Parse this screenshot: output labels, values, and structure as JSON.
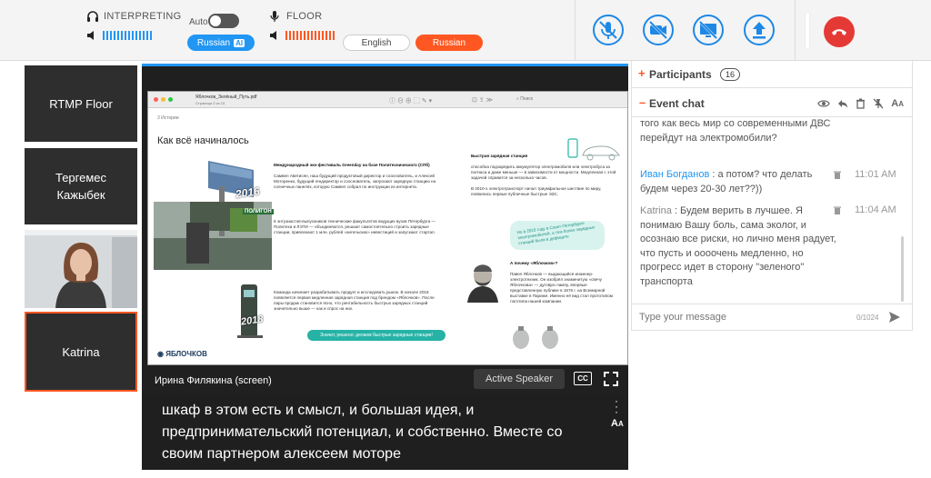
{
  "toolbar": {
    "interpreting_label": "INTERPRETING",
    "auto_label": "Auto",
    "interpreting_lang_button": "Russian",
    "ai_badge": "AI",
    "floor_label": "FLOOR",
    "lang_options": [
      "English",
      "Russian"
    ],
    "selected_lang": "Russian",
    "colors": {
      "accent_blue": "#2196f3",
      "accent_orange": "#ff5722",
      "hangup_red": "#e53935"
    },
    "controls": [
      {
        "name": "mute-mic-button",
        "icon": "mic-off-icon"
      },
      {
        "name": "camera-off-button",
        "icon": "camera-off-icon"
      },
      {
        "name": "screen-share-off-button",
        "icon": "screen-share-off-icon"
      },
      {
        "name": "upload-button",
        "icon": "upload-icon"
      }
    ]
  },
  "participants_tiles": [
    {
      "name": "RTMP Floor"
    },
    {
      "name": "Тергемес\nКажыбек"
    },
    {
      "name": ""
    },
    {
      "name": "Katrina"
    }
  ],
  "stage": {
    "slide": {
      "file_name": "Яблочков_Зелёный_Путь.pdf",
      "page_info": "Страница 3 из 15",
      "search_placeholder": "Поиск",
      "section_tag": "3   Истории",
      "heading": "Как всё начиналось",
      "para1_title": "Международный эко-фестиваль Greenday на базе Политехнического (СПб)",
      "para1_body": "Самвел Аветисян, наш будущий продуктовый директор и сооснователь, и Алексей Моторенко, будущий гендиректор и сооснователь, запускают зарядную станцию на солнечных панелях, которую Самвел собрал по инструкции из интернета.",
      "para2_body": "6 энтузиастов-выпускников технические факультетов ведущих вузов Петербурга — Политеха и ЛЭТИ — объединяются, решают самостоятельно строить зарядные станции, привлекают 1 млн. рублей «ангельских» инвестиций и запускают стартап.",
      "para3_body": "Команда начинает разрабатывать продукт и исследовать рынок. В начале 2018 появляется первая медленная зарядная станция под брендом «Яблочков». После пары продаж становится ясно, что рентабельность быстрых зарядных станций значительно выше — как и спрос на них.",
      "right_title": "Быстрая зарядная станция",
      "right_body1": "способна подзарядить аккумулятор электромобиля или электробуса за полчаса и даже меньше — в зависимости от мощности. Медленная с этой задачей справится за несколько часов.",
      "right_body2": "В 2010-х электротранспорт начал триумфальное шествие по миру, появились первые публичные быстрые ЭЗС.",
      "right_callout": "Но в 2016 году в Санкт-Петербурге электромобилей, а тем более зарядных станций были в дефиците",
      "why_title": "А почему «Яблочков»?",
      "why_body": "Павел Яблочков — выдающийся инженер-электротехник. Он изобрёл знаменитую «свечу Яблочкова» — дуговую лампу, впервые представленную публике в 1876 г. на Всемирной выставке в Париже. Именно её вид стал прототипом логотипа нашей компании.",
      "bottom_pill": "Значит, решено: делаем быстрые зарядные станции!",
      "logo_text": "ЯБЛОЧКОВ",
      "charger_label": "ПОЛИГОН",
      "year1": "2016",
      "year2": "2018"
    },
    "presenter_name": "Ирина Филякина (screen)",
    "active_speaker_label": "Active Speaker",
    "cc_label": "CC",
    "caption_text": "шкаф в этом есть и смысл, и большая идея, и предпринимательский потенциал, и собственно. Вместе со своим партнером алексеем моторе",
    "font_size_label": "A"
  },
  "panel": {
    "participants_label": "Participants",
    "participants_count": "16",
    "event_chat_label": "Event chat",
    "messages": [
      {
        "author": "",
        "text": "того как весь мир со современными ДВС перейдут на электромобили?",
        "time": ""
      },
      {
        "author": "Иван Богданов",
        "text": "а потом? что делать будем через 20-30 лет??))",
        "time": "11:01 AM"
      },
      {
        "author": "Katrina",
        "text": "Будем верить в лучшее. Я понимаю Вашу боль, сама эколог, и осознаю все риски, но лично меня радует, что пусть и оооочень медленно, но прогресс идет в сторону \"зеленого\" транспорта",
        "time": "11:04 AM"
      }
    ],
    "composer_placeholder": "Type your message",
    "char_counter": "0/1024",
    "font_label": "A"
  }
}
